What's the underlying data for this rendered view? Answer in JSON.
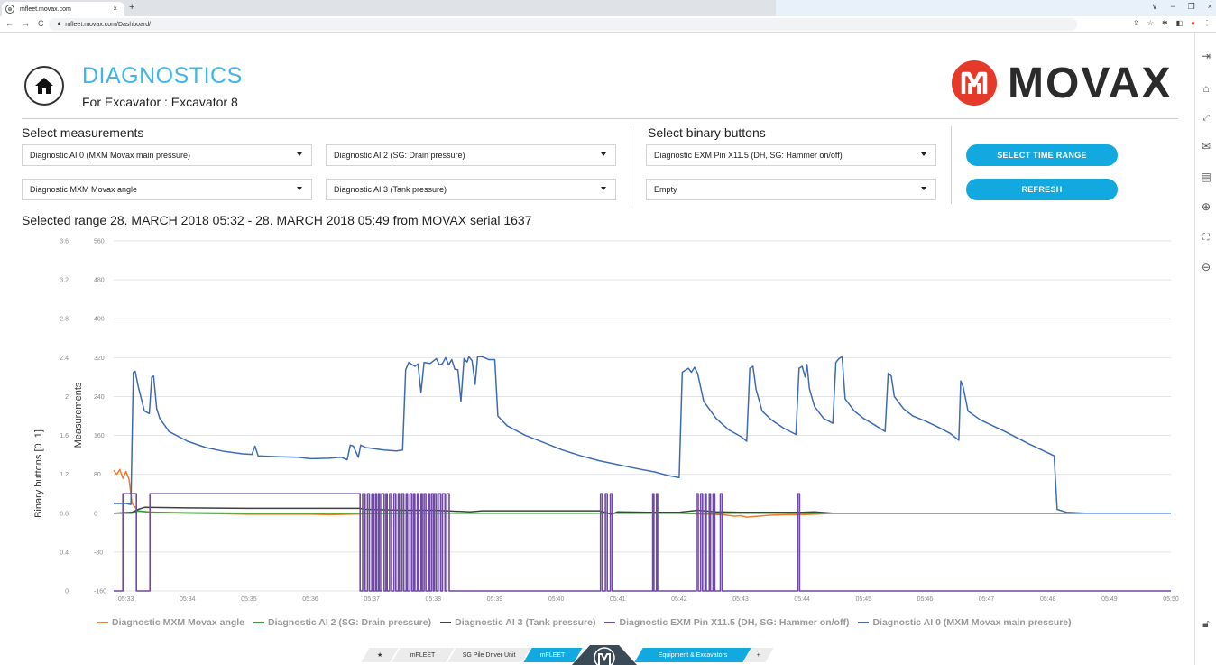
{
  "browser": {
    "tab_title": "mfleet.movax.com",
    "tab_close": "×",
    "new_tab": "+",
    "url": "mfleet.movax.com/Dashboard/",
    "nav": [
      "←",
      "→",
      "C"
    ],
    "window_controls": [
      "∨",
      "−",
      "❐",
      "×"
    ]
  },
  "header": {
    "title": "DIAGNOSTICS",
    "subtitle": "For Excavator : Excavator 8",
    "logo_text": "MOVAX"
  },
  "measurements": {
    "label": "Select measurements",
    "dd1": "Diagnostic AI 0 (MXM Movax main pressure)",
    "dd2": "Diagnostic AI 2 (SG: Drain pressure)",
    "dd3": "Diagnostic MXM Movax angle",
    "dd4": "Diagnostic AI 3 (Tank pressure)"
  },
  "binary": {
    "label": "Select binary buttons",
    "dd1": "Diagnostic EXM Pin X11.5 (DH, SG: Hammer on/off)",
    "dd2": "Empty"
  },
  "buttons": {
    "time_range": "SELECT TIME RANGE",
    "refresh": "REFRESH"
  },
  "range_text": "Selected range 28. MARCH 2018 05:32 - 28. MARCH 2018 05:49 from MOVAX serial 1637",
  "footer": {
    "star": "★",
    "tab1": "mFLEET",
    "tab2": "SG Pile Driver Unit",
    "tab3": "mFLEET",
    "tab4": "Equipment & Excavators",
    "plus": "+"
  },
  "colors": {
    "accent": "#12a9e0",
    "title": "#3fb6e8",
    "logo_red": "#e53a2a"
  },
  "chart_data": {
    "type": "line",
    "ylabel_left": "Binary buttons [0..1]",
    "ylabel_right": "Measurements",
    "y_binary_ticks": [
      "0",
      "0.4",
      "0.8",
      "1.2",
      "1.6",
      "2",
      "2.4",
      "2.8",
      "3.2",
      "3.6"
    ],
    "y_meas_ticks": [
      "-160",
      "-80",
      "0",
      "80",
      "160",
      "240",
      "320",
      "400",
      "480",
      "560"
    ],
    "ylim_binary": [
      0,
      3.6
    ],
    "ylim_measurements": [
      -160,
      560
    ],
    "x_ticks": [
      "05:33",
      "05:34",
      "05:35",
      "05:36",
      "05:37",
      "05:38",
      "05:39",
      "05:40",
      "05:41",
      "05:42",
      "05:43",
      "05:44",
      "05:45",
      "05:46",
      "05:47",
      "05:48",
      "05:49",
      "05:50"
    ],
    "xlim_minutes": [
      32.8,
      50
    ],
    "grid": true,
    "legend_position": "bottom",
    "series": [
      {
        "name": "Diagnostic MXM Movax angle",
        "color": "#ed7d31",
        "axis": "measurements",
        "points": [
          [
            32.8,
            88
          ],
          [
            32.85,
            80
          ],
          [
            32.9,
            90
          ],
          [
            32.95,
            72
          ],
          [
            33.0,
            86
          ],
          [
            33.05,
            70
          ],
          [
            33.1,
            20
          ],
          [
            33.2,
            4
          ],
          [
            33.5,
            2
          ],
          [
            34.0,
            0
          ],
          [
            35.0,
            -2
          ],
          [
            36.0,
            -2
          ],
          [
            36.3,
            -3
          ],
          [
            37.0,
            -1
          ],
          [
            38.0,
            0
          ],
          [
            39.0,
            0
          ],
          [
            40.0,
            0
          ],
          [
            41.0,
            0
          ],
          [
            42.0,
            0
          ],
          [
            42.5,
            -2
          ],
          [
            42.7,
            -3
          ],
          [
            42.9,
            -6
          ],
          [
            43.0,
            -5
          ],
          [
            43.1,
            -8
          ],
          [
            43.3,
            -6
          ],
          [
            43.5,
            -4
          ],
          [
            43.8,
            -3
          ],
          [
            44.0,
            -3
          ],
          [
            44.2,
            -2
          ],
          [
            44.5,
            0
          ],
          [
            45.0,
            0
          ],
          [
            46.0,
            0
          ],
          [
            47.0,
            0
          ],
          [
            48.0,
            0
          ],
          [
            49.0,
            0
          ],
          [
            50.0,
            0
          ]
        ]
      },
      {
        "name": "Diagnostic AI 2 (SG: Drain pressure)",
        "color": "#3a9a3a",
        "axis": "measurements",
        "points": [
          [
            32.8,
            0
          ],
          [
            33.1,
            0
          ],
          [
            33.2,
            5
          ],
          [
            33.4,
            2
          ],
          [
            34.0,
            1
          ],
          [
            35.0,
            0
          ],
          [
            36.0,
            0
          ],
          [
            36.8,
            0
          ],
          [
            37.0,
            0
          ],
          [
            38.0,
            0
          ],
          [
            38.6,
            0
          ],
          [
            39.0,
            0
          ],
          [
            40.0,
            0
          ],
          [
            40.7,
            0
          ],
          [
            41.0,
            0
          ],
          [
            42.0,
            0
          ],
          [
            42.3,
            0
          ],
          [
            43.0,
            0
          ],
          [
            44.0,
            0
          ],
          [
            44.4,
            0
          ],
          [
            45.0,
            0
          ],
          [
            46.0,
            0
          ],
          [
            47.0,
            0
          ],
          [
            48.0,
            0
          ],
          [
            49.0,
            0
          ],
          [
            50.0,
            0
          ]
        ]
      },
      {
        "name": "Diagnostic AI 3 (Tank pressure)",
        "color": "#404040",
        "axis": "measurements",
        "points": [
          [
            32.8,
            0
          ],
          [
            33.1,
            2
          ],
          [
            33.2,
            8
          ],
          [
            33.3,
            12
          ],
          [
            34.0,
            11
          ],
          [
            35.0,
            10
          ],
          [
            36.0,
            10
          ],
          [
            36.8,
            10
          ],
          [
            36.9,
            8
          ],
          [
            37.5,
            6
          ],
          [
            38.0,
            6
          ],
          [
            38.6,
            3
          ],
          [
            38.8,
            5
          ],
          [
            39.0,
            5
          ],
          [
            40.0,
            5
          ],
          [
            40.7,
            5
          ],
          [
            40.9,
            -2
          ],
          [
            41.0,
            3
          ],
          [
            41.5,
            2
          ],
          [
            42.0,
            2
          ],
          [
            42.3,
            6
          ],
          [
            42.6,
            3
          ],
          [
            43.0,
            2
          ],
          [
            43.5,
            2
          ],
          [
            44.0,
            2
          ],
          [
            44.2,
            3
          ],
          [
            44.5,
            0
          ],
          [
            45.0,
            0
          ],
          [
            46.0,
            0
          ],
          [
            47.0,
            0
          ],
          [
            48.0,
            0
          ],
          [
            49.0,
            0
          ],
          [
            50.0,
            0
          ]
        ]
      },
      {
        "name": "Diagnostic EXM Pin X11.5 (DH, SG: Hammer on/off)",
        "color": "#6e4aa0",
        "axis": "binary",
        "on_intervals_minutes": [
          [
            32.95,
            33.17
          ],
          [
            33.39,
            36.81
          ],
          [
            36.85,
            36.89
          ],
          [
            36.93,
            36.96
          ],
          [
            37.0,
            37.03
          ],
          [
            37.06,
            37.08
          ],
          [
            37.11,
            37.13
          ],
          [
            37.16,
            37.2
          ],
          [
            37.23,
            37.25
          ],
          [
            37.29,
            37.32
          ],
          [
            37.36,
            37.39
          ],
          [
            37.43,
            37.45
          ],
          [
            37.49,
            37.52
          ],
          [
            37.56,
            37.58
          ],
          [
            37.62,
            37.65
          ],
          [
            37.68,
            37.7
          ],
          [
            37.74,
            37.76
          ],
          [
            37.8,
            37.82
          ],
          [
            37.85,
            37.88
          ],
          [
            37.92,
            37.94
          ],
          [
            37.97,
            38.0
          ],
          [
            38.02,
            38.05
          ],
          [
            38.08,
            38.12
          ],
          [
            38.15,
            38.19
          ],
          [
            38.22,
            38.26
          ],
          [
            40.72,
            40.75
          ],
          [
            40.8,
            40.83
          ],
          [
            40.88,
            40.91
          ],
          [
            41.57,
            41.59
          ],
          [
            41.63,
            41.65
          ],
          [
            42.28,
            42.31
          ],
          [
            42.35,
            42.38
          ],
          [
            42.42,
            42.44
          ],
          [
            42.49,
            42.51
          ],
          [
            42.55,
            42.58
          ],
          [
            42.67,
            42.7
          ],
          [
            43.93,
            43.96
          ]
        ]
      },
      {
        "name": "Diagnostic AI 0 (MXM Movax main pressure)",
        "color": "#3d6bb3",
        "axis": "measurements",
        "points": [
          [
            32.8,
            20
          ],
          [
            33.0,
            20
          ],
          [
            33.08,
            18
          ],
          [
            33.12,
            290
          ],
          [
            33.15,
            292
          ],
          [
            33.2,
            260
          ],
          [
            33.3,
            210
          ],
          [
            33.38,
            205
          ],
          [
            33.42,
            280
          ],
          [
            33.45,
            282
          ],
          [
            33.5,
            215
          ],
          [
            33.55,
            195
          ],
          [
            33.7,
            168
          ],
          [
            34.0,
            148
          ],
          [
            34.3,
            135
          ],
          [
            34.6,
            127
          ],
          [
            34.9,
            122
          ],
          [
            35.05,
            121
          ],
          [
            35.1,
            138
          ],
          [
            35.15,
            118
          ],
          [
            35.5,
            116
          ],
          [
            35.8,
            115
          ],
          [
            36.0,
            112
          ],
          [
            36.3,
            113
          ],
          [
            36.5,
            115
          ],
          [
            36.6,
            110
          ],
          [
            36.65,
            140
          ],
          [
            36.7,
            138
          ],
          [
            36.78,
            115
          ],
          [
            36.82,
            140
          ],
          [
            36.9,
            135
          ],
          [
            37.2,
            130
          ],
          [
            37.4,
            128
          ],
          [
            37.5,
            130
          ],
          [
            37.55,
            295
          ],
          [
            37.6,
            310
          ],
          [
            37.7,
            302
          ],
          [
            37.75,
            307
          ],
          [
            37.8,
            248
          ],
          [
            37.85,
            310
          ],
          [
            37.95,
            308
          ],
          [
            38.05,
            318
          ],
          [
            38.1,
            305
          ],
          [
            38.15,
            308
          ],
          [
            38.2,
            320
          ],
          [
            38.25,
            305
          ],
          [
            38.3,
            316
          ],
          [
            38.35,
            296
          ],
          [
            38.4,
            295
          ],
          [
            38.45,
            230
          ],
          [
            38.5,
            318
          ],
          [
            38.55,
            311
          ],
          [
            38.58,
            322
          ],
          [
            38.63,
            314
          ],
          [
            38.68,
            265
          ],
          [
            38.72,
            322
          ],
          [
            38.8,
            322
          ],
          [
            38.9,
            316
          ],
          [
            39.0,
            316
          ],
          [
            39.05,
            200
          ],
          [
            39.2,
            180
          ],
          [
            39.5,
            160
          ],
          [
            39.8,
            145
          ],
          [
            40.1,
            130
          ],
          [
            40.4,
            118
          ],
          [
            40.7,
            108
          ],
          [
            41.0,
            100
          ],
          [
            41.3,
            92
          ],
          [
            41.6,
            85
          ],
          [
            41.8,
            78
          ],
          [
            42.0,
            73
          ],
          [
            42.05,
            290
          ],
          [
            42.15,
            298
          ],
          [
            42.2,
            290
          ],
          [
            42.25,
            300
          ],
          [
            42.3,
            288
          ],
          [
            42.4,
            230
          ],
          [
            42.6,
            195
          ],
          [
            42.8,
            172
          ],
          [
            43.0,
            158
          ],
          [
            43.1,
            148
          ],
          [
            43.15,
            298
          ],
          [
            43.2,
            302
          ],
          [
            43.25,
            255
          ],
          [
            43.35,
            210
          ],
          [
            43.5,
            192
          ],
          [
            43.7,
            175
          ],
          [
            43.9,
            162
          ],
          [
            43.95,
            298
          ],
          [
            44.0,
            302
          ],
          [
            44.05,
            280
          ],
          [
            44.08,
            306
          ],
          [
            44.12,
            256
          ],
          [
            44.2,
            220
          ],
          [
            44.35,
            195
          ],
          [
            44.5,
            185
          ],
          [
            44.55,
            310
          ],
          [
            44.6,
            318
          ],
          [
            44.65,
            322
          ],
          [
            44.7,
            235
          ],
          [
            44.85,
            210
          ],
          [
            45.0,
            195
          ],
          [
            45.2,
            180
          ],
          [
            45.35,
            168
          ],
          [
            45.4,
            288
          ],
          [
            45.45,
            282
          ],
          [
            45.5,
            240
          ],
          [
            45.65,
            215
          ],
          [
            45.8,
            200
          ],
          [
            46.0,
            190
          ],
          [
            46.2,
            178
          ],
          [
            46.4,
            165
          ],
          [
            46.55,
            150
          ],
          [
            46.58,
            272
          ],
          [
            46.62,
            260
          ],
          [
            46.7,
            210
          ],
          [
            46.9,
            192
          ],
          [
            47.1,
            180
          ],
          [
            47.3,
            168
          ],
          [
            47.5,
            155
          ],
          [
            47.7,
            142
          ],
          [
            47.9,
            130
          ],
          [
            48.1,
            118
          ],
          [
            48.15,
            8
          ],
          [
            48.3,
            2
          ],
          [
            48.6,
            0
          ],
          [
            49.0,
            0
          ],
          [
            50.0,
            0
          ],
          [
            50.5,
            0
          ]
        ]
      }
    ]
  }
}
